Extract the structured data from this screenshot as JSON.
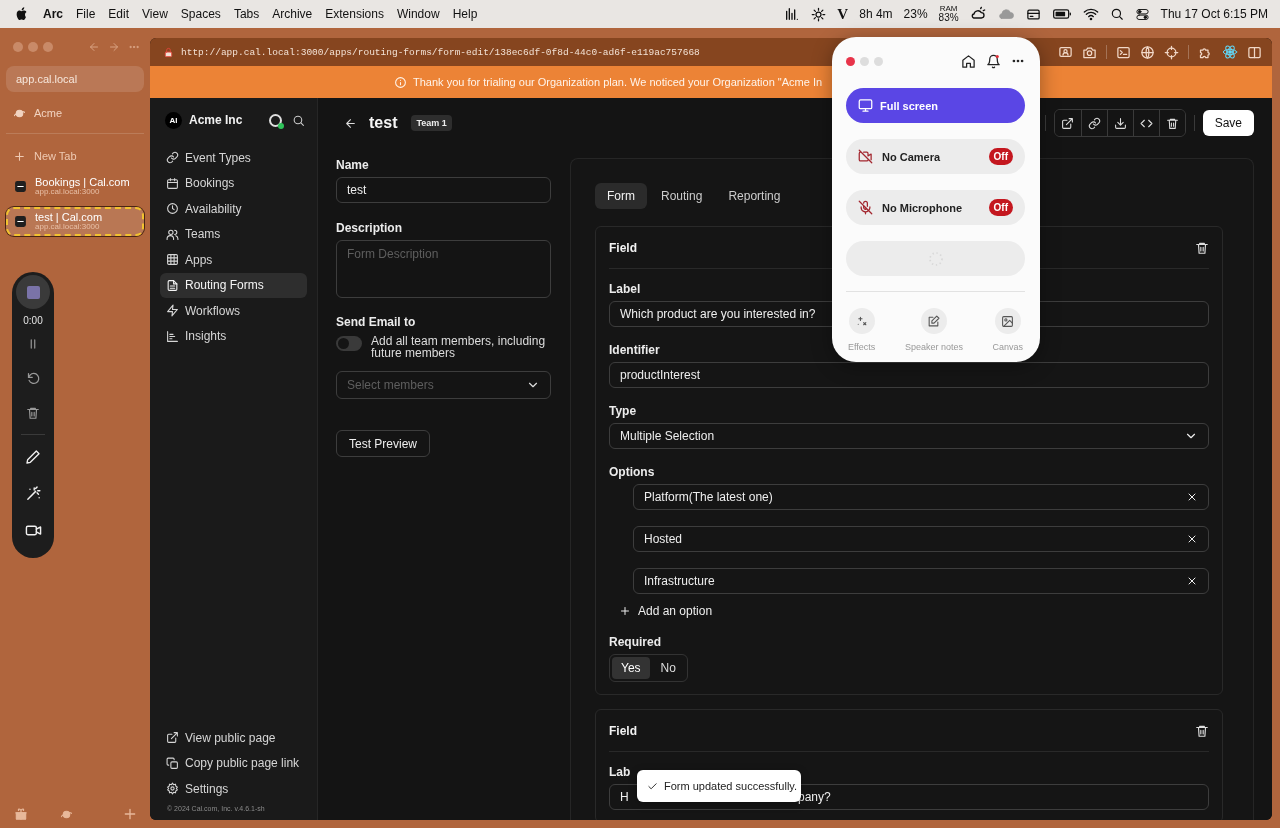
{
  "menubar": {
    "app": "Arc",
    "menus": [
      "File",
      "Edit",
      "View",
      "Spaces",
      "Tabs",
      "Archive",
      "Extensions",
      "Window",
      "Help"
    ],
    "status": {
      "letter": "V",
      "battery_time": "8h 4m",
      "cpu": "23%",
      "ram_label": "RAM",
      "ram_value": "83%"
    },
    "clock": "Thu 17 Oct 6:15 PM"
  },
  "arc_sidebar": {
    "url": "app.cal.local",
    "space": "Acme",
    "new_tab": "New Tab",
    "tabs": [
      {
        "title": "Bookings | Cal.com",
        "url": "app.cal.local:3000",
        "selected": false
      },
      {
        "title": "test | Cal.com",
        "url": "app.cal.local:3000",
        "selected": true
      }
    ]
  },
  "recorder": {
    "time": "0:00"
  },
  "browser": {
    "address": "http://app.cal.local:3000/apps/routing-forms/form-edit/138ec6df-0f8d-44c0-ad6f-e119ac757668",
    "banner": "Thank you for trialing our Organization plan. We noticed your Organization \"Acme In"
  },
  "cal_sidebar": {
    "org_initials": "AI",
    "org": "Acme Inc",
    "nav": [
      {
        "label": "Event Types",
        "selected": false
      },
      {
        "label": "Bookings",
        "selected": false
      },
      {
        "label": "Availability",
        "selected": false
      },
      {
        "label": "Teams",
        "selected": false
      },
      {
        "label": "Apps",
        "selected": false
      },
      {
        "label": "Routing Forms",
        "selected": true
      },
      {
        "label": "Workflows",
        "selected": false
      },
      {
        "label": "Insights",
        "selected": false
      }
    ],
    "footer": [
      "View public page",
      "Copy public page link",
      "Settings"
    ],
    "copyright": "© 2024 Cal.com, Inc. v.4.6.1-sh"
  },
  "header": {
    "title": "test",
    "team": "Team 1",
    "save": "Save"
  },
  "settings": {
    "name_label": "Name",
    "name_value": "test",
    "description_label": "Description",
    "description_placeholder": "Form Description",
    "send_email_label": "Send Email to",
    "toggle": {
      "label": "Add all team members, including future members",
      "on": false
    },
    "members_placeholder": "Select members",
    "test_preview": "Test Preview"
  },
  "tabs": [
    {
      "label": "Form",
      "selected": true
    },
    {
      "label": "Routing",
      "selected": false
    },
    {
      "label": "Reporting",
      "selected": false
    }
  ],
  "fields": [
    {
      "title": "Field",
      "label_caption": "Label",
      "label_value": "Which product are you interested in?",
      "identifier_caption": "Identifier",
      "identifier_value": "productInterest",
      "type_caption": "Type",
      "type_value": "Multiple Selection",
      "options_caption": "Options",
      "options": [
        "Platform(The latest one)",
        "Hosted",
        "Infrastructure"
      ],
      "add_option": "Add an option",
      "required_caption": "Required",
      "required": [
        {
          "label": "Yes",
          "selected": true
        },
        {
          "label": "No",
          "selected": false
        }
      ]
    },
    {
      "title": "Field",
      "label_caption": "Lab",
      "label_value_start": "H",
      "label_value_end": "pany?"
    }
  ],
  "toast": "Form updated successfully.",
  "popup": {
    "primary": "Full screen",
    "devices": [
      {
        "kind": "camera",
        "label": "No Camera",
        "status": "Off"
      },
      {
        "kind": "microphone",
        "label": "No Microphone",
        "status": "Off"
      }
    ],
    "tools": [
      "Effects",
      "Speaker notes",
      "Canvas"
    ]
  }
}
